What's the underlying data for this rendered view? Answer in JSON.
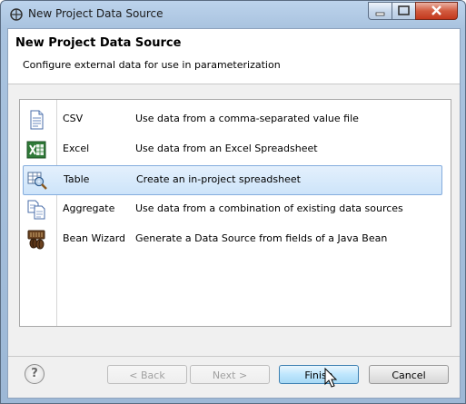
{
  "window": {
    "title": "New Project Data Source"
  },
  "header": {
    "title": "New Project Data Source",
    "description": "Configure external data for use in parameterization"
  },
  "sources": [
    {
      "name": "CSV",
      "description": "Use data from a comma-separated value file",
      "icon": "csv-file-icon",
      "selected": false
    },
    {
      "name": "Excel",
      "description": "Use data from an Excel Spreadsheet",
      "icon": "excel-icon",
      "selected": false
    },
    {
      "name": "Table",
      "description": "Create an in-project spreadsheet",
      "icon": "table-search-icon",
      "selected": true
    },
    {
      "name": "Aggregate",
      "description": "Use data from a combination of existing data sources",
      "icon": "aggregate-icon",
      "selected": false
    },
    {
      "name": "Bean Wizard",
      "description": "Generate a Data Source from fields of a Java Bean",
      "icon": "java-bean-icon",
      "selected": false
    }
  ],
  "buttons": {
    "back": "< Back",
    "next": "Next >",
    "finish": "Finish",
    "cancel": "Cancel"
  },
  "help": {
    "glyph": "?"
  }
}
